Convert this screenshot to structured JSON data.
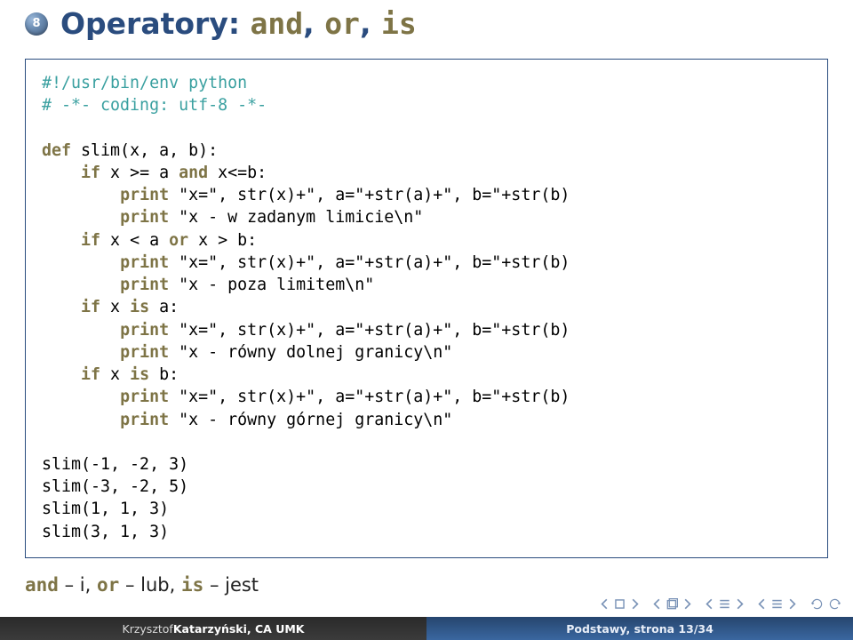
{
  "badge": "8",
  "title_prefix": "Operatory:",
  "title_kw1": "and",
  "title_kw2": "or",
  "title_kw3": "is",
  "code": {
    "l1a": "#!/usr/bin/env python",
    "l2a": "# -*- coding: utf-8 -*-",
    "l4_def": "def",
    "l4_rest": " slim(x, a, b):",
    "l5_if": "if",
    "l5_a": " x >= a ",
    "l5_and": "and",
    "l5_b": " x<=b:",
    "l6_print": "print",
    "l6_rest": " \"x=\", str(x)+\", a=\"+str(a)+\", b=\"+str(b)",
    "l7_print": "print",
    "l7_rest": " \"x - w zadanym limicie\\n\"",
    "l8_if": "if",
    "l8_a": " x < a ",
    "l8_or": "or",
    "l8_b": " x > b:",
    "l9_print": "print",
    "l9_rest": " \"x=\", str(x)+\", a=\"+str(a)+\", b=\"+str(b)",
    "l10_print": "print",
    "l10_rest": " \"x - poza limitem\\n\"",
    "l11_if": "if",
    "l11_a": " x ",
    "l11_is": "is",
    "l11_b": " a:",
    "l12_print": "print",
    "l12_rest": " \"x=\", str(x)+\", a=\"+str(a)+\", b=\"+str(b)",
    "l13_print": "print",
    "l13_rest": " \"x - równy dolnej granicy\\n\"",
    "l14_if": "if",
    "l14_a": " x ",
    "l14_is": "is",
    "l14_b": " b:",
    "l15_print": "print",
    "l15_rest": " \"x=\", str(x)+\", a=\"+str(a)+\", b=\"+str(b)",
    "l16_print": "print",
    "l16_rest": " \"x - równy górnej granicy\\n\"",
    "c1": "slim(-1, -2, 3)",
    "c2": "slim(-3, -2, 5)",
    "c3": "slim(1, 1, 3)",
    "c4": "slim(3, 1, 3)"
  },
  "note": {
    "and": "and",
    "and_desc": " – i, ",
    "or": "or",
    "or_desc": " – lub, ",
    "is": "is",
    "is_desc": " – jest"
  },
  "footer": {
    "author_plain": "Krzysztof ",
    "author_bold": "Katarzyński, CA UMK",
    "page": "Podstawy, strona 13/34"
  }
}
